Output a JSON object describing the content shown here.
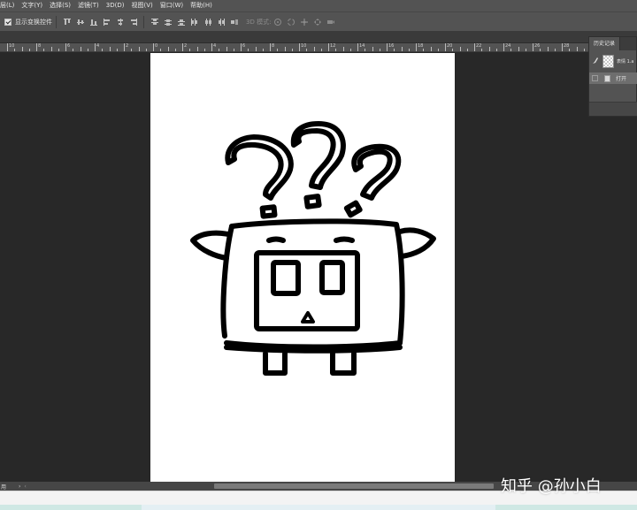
{
  "menu": {
    "items": [
      "层(L)",
      "文字(Y)",
      "选择(S)",
      "滤镜(T)",
      "3D(D)",
      "视图(V)",
      "窗口(W)",
      "帮助(H)"
    ]
  },
  "options_bar": {
    "show_transform_label": "显示变换控件",
    "show_transform_checked": true,
    "mode_3d_label": "3D 模式:",
    "icons": [
      "align-top-icon",
      "align-vcenter-icon",
      "align-bottom-icon",
      "align-left-icon",
      "align-hcenter-icon",
      "align-right-icon",
      "distribute-top-icon",
      "distribute-vcenter-icon",
      "distribute-bottom-icon",
      "distribute-left-icon",
      "distribute-hcenter-icon",
      "distribute-right-icon",
      "auto-align-icon"
    ],
    "mode_icons": [
      "3d-rotate-icon",
      "3d-roll-icon",
      "3d-pan-icon",
      "3d-slide-icon",
      "3d-scale-icon"
    ]
  },
  "ruler": {
    "labels": [
      "10",
      "8",
      "6",
      "4",
      "2",
      "0",
      "2",
      "4",
      "6",
      "8",
      "10",
      "12",
      "14",
      "16",
      "18",
      "20",
      "22",
      "24",
      "26",
      "28"
    ]
  },
  "history": {
    "tab_label": "历史记录",
    "snapshot_label": "表情 1.a",
    "state_label": "打开"
  },
  "status": {
    "text": "用"
  },
  "watermark": "知乎 @孙小白"
}
